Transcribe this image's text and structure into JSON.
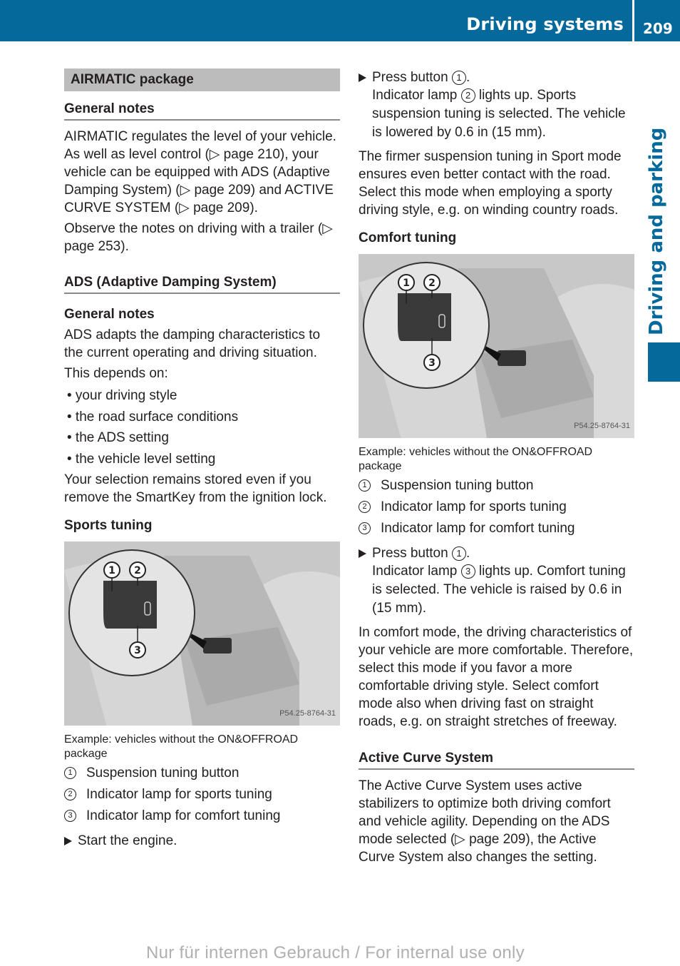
{
  "header": {
    "section_title": "Driving systems",
    "page_number": "209",
    "side_tab": "Driving and parking",
    "brand_color": "#05699c"
  },
  "left": {
    "section_bar": "AIRMATIC package",
    "general_notes_heading": "General notes",
    "general_p1": "AIRMATIC regulates the level of your vehicle. As well as level control (▷ page 210), your vehicle can be equipped with ADS (Adaptive Damping System) (▷ page 209) and ACTIVE CURVE SYSTEM (▷ page 209).",
    "general_p2": "Observe the notes on driving with a trailer (▷ page 253).",
    "ads_heading": "ADS (Adaptive Damping System)",
    "ads_general_heading": "General notes",
    "ads_p1": "ADS adapts the damping characteristics to the current operating and driving situation.",
    "ads_p2": "This depends on:",
    "bullets": [
      "• your driving style",
      "• the road surface conditions",
      "• the ADS setting",
      "• the vehicle level setting"
    ],
    "ads_p3": "Your selection remains stored even if you remove the SmartKey from the ignition lock.",
    "sports_heading": "Sports tuning",
    "figure_code": "P54.25-8764-31",
    "figure_caption": "Example: vehicles without the ON&OFFROAD package",
    "legend": [
      {
        "num": "1",
        "text": "Suspension tuning button"
      },
      {
        "num": "2",
        "text": "Indicator lamp for sports tuning"
      },
      {
        "num": "3",
        "text": "Indicator lamp for comfort tuning"
      }
    ],
    "step": "Start the engine."
  },
  "right": {
    "sport_step_prefix": "Press button ",
    "sport_step_num": "1",
    "sport_step_suffix": ".",
    "sport_result_prefix": "Indicator lamp ",
    "sport_result_num": "2",
    "sport_result_suffix": " lights up. Sports suspension tuning is selected. The vehicle is lowered by 0.6 in (15 mm).",
    "sport_p": "The firmer suspension tuning in Sport mode ensures even better contact with the road. Select this mode when employing a sporty driving style, e.g. on winding country roads.",
    "comfort_heading": "Comfort tuning",
    "figure_code": "P54.25-8764-31",
    "figure_caption": "Example: vehicles without the ON&OFFROAD package",
    "legend": [
      {
        "num": "1",
        "text": "Suspension tuning button"
      },
      {
        "num": "2",
        "text": "Indicator lamp for sports tuning"
      },
      {
        "num": "3",
        "text": "Indicator lamp for comfort tuning"
      }
    ],
    "comfort_step_prefix": "Press button ",
    "comfort_step_num": "1",
    "comfort_step_suffix": ".",
    "comfort_result_prefix": "Indicator lamp ",
    "comfort_result_num": "3",
    "comfort_result_suffix": " lights up. Comfort tuning is selected. The vehicle is raised by 0.6 in (15 mm).",
    "comfort_p": "In comfort mode, the driving characteristics of your vehicle are more comfortable. Therefore, select this mode if you favor a more comfortable driving style. Select comfort mode also when driving fast on straight roads, e.g. on straight stretches of freeway.",
    "acs_heading": "Active Curve System",
    "acs_p": "The Active Curve System uses active stabilizers to optimize both driving comfort and vehicle agility. Depending on the ADS mode selected (▷ page 209), the Active Curve System also changes the setting."
  },
  "footer": {
    "watermark": "Nur für internen Gebrauch / For internal use only"
  }
}
